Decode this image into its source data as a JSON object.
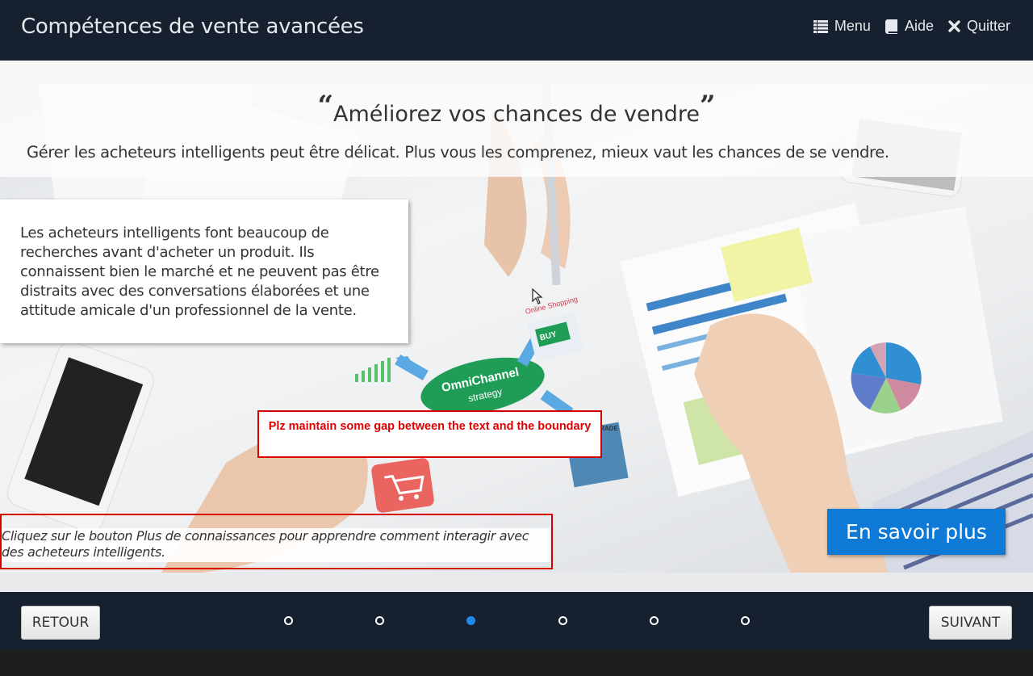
{
  "header": {
    "title": "Compétences de vente avancées",
    "nav": [
      {
        "label": "Menu",
        "icon": "list-icon"
      },
      {
        "label": "Aide",
        "icon": "book-icon"
      },
      {
        "label": "Quitter",
        "icon": "close-icon"
      }
    ]
  },
  "slide": {
    "quote_title": "Améliorez vos chances de vendre",
    "quote_open": "“",
    "quote_close": "”",
    "subtitle": "Gérer les acheteurs intelligents peut être délicat. Plus vous les comprenez, mieux vaut les chances de se vendre.",
    "info_text": "Les acheteurs intelligents font beaucoup de recherches avant d'acheter un produit. Ils connaissent bien le marché et ne peuvent pas être distraits avec des conversations élaborées et une attitude amicale d'un professionnel de la vente.",
    "review_note": "Plz maintain some gap between the text and the boundary",
    "instruction": "Cliquez sur le bouton Plus de connaissances pour apprendre comment interagir avec des acheteurs intelligents.",
    "learn_more_label": "En savoir plus",
    "photo_labels": {
      "omnichannel_line1": "OmniChannel",
      "omnichannel_line2": "strategy",
      "buy": "BUY",
      "online_shopping": "Online Shopping",
      "trade": "N TRADE"
    }
  },
  "footer": {
    "back_label": "RETOUR",
    "next_label": "SUIVANT",
    "pagination": {
      "total": 6,
      "current": 3
    }
  },
  "colors": {
    "header_bg": "#17202e",
    "accent": "#0f7ad6",
    "annotation_red": "#e00000"
  }
}
